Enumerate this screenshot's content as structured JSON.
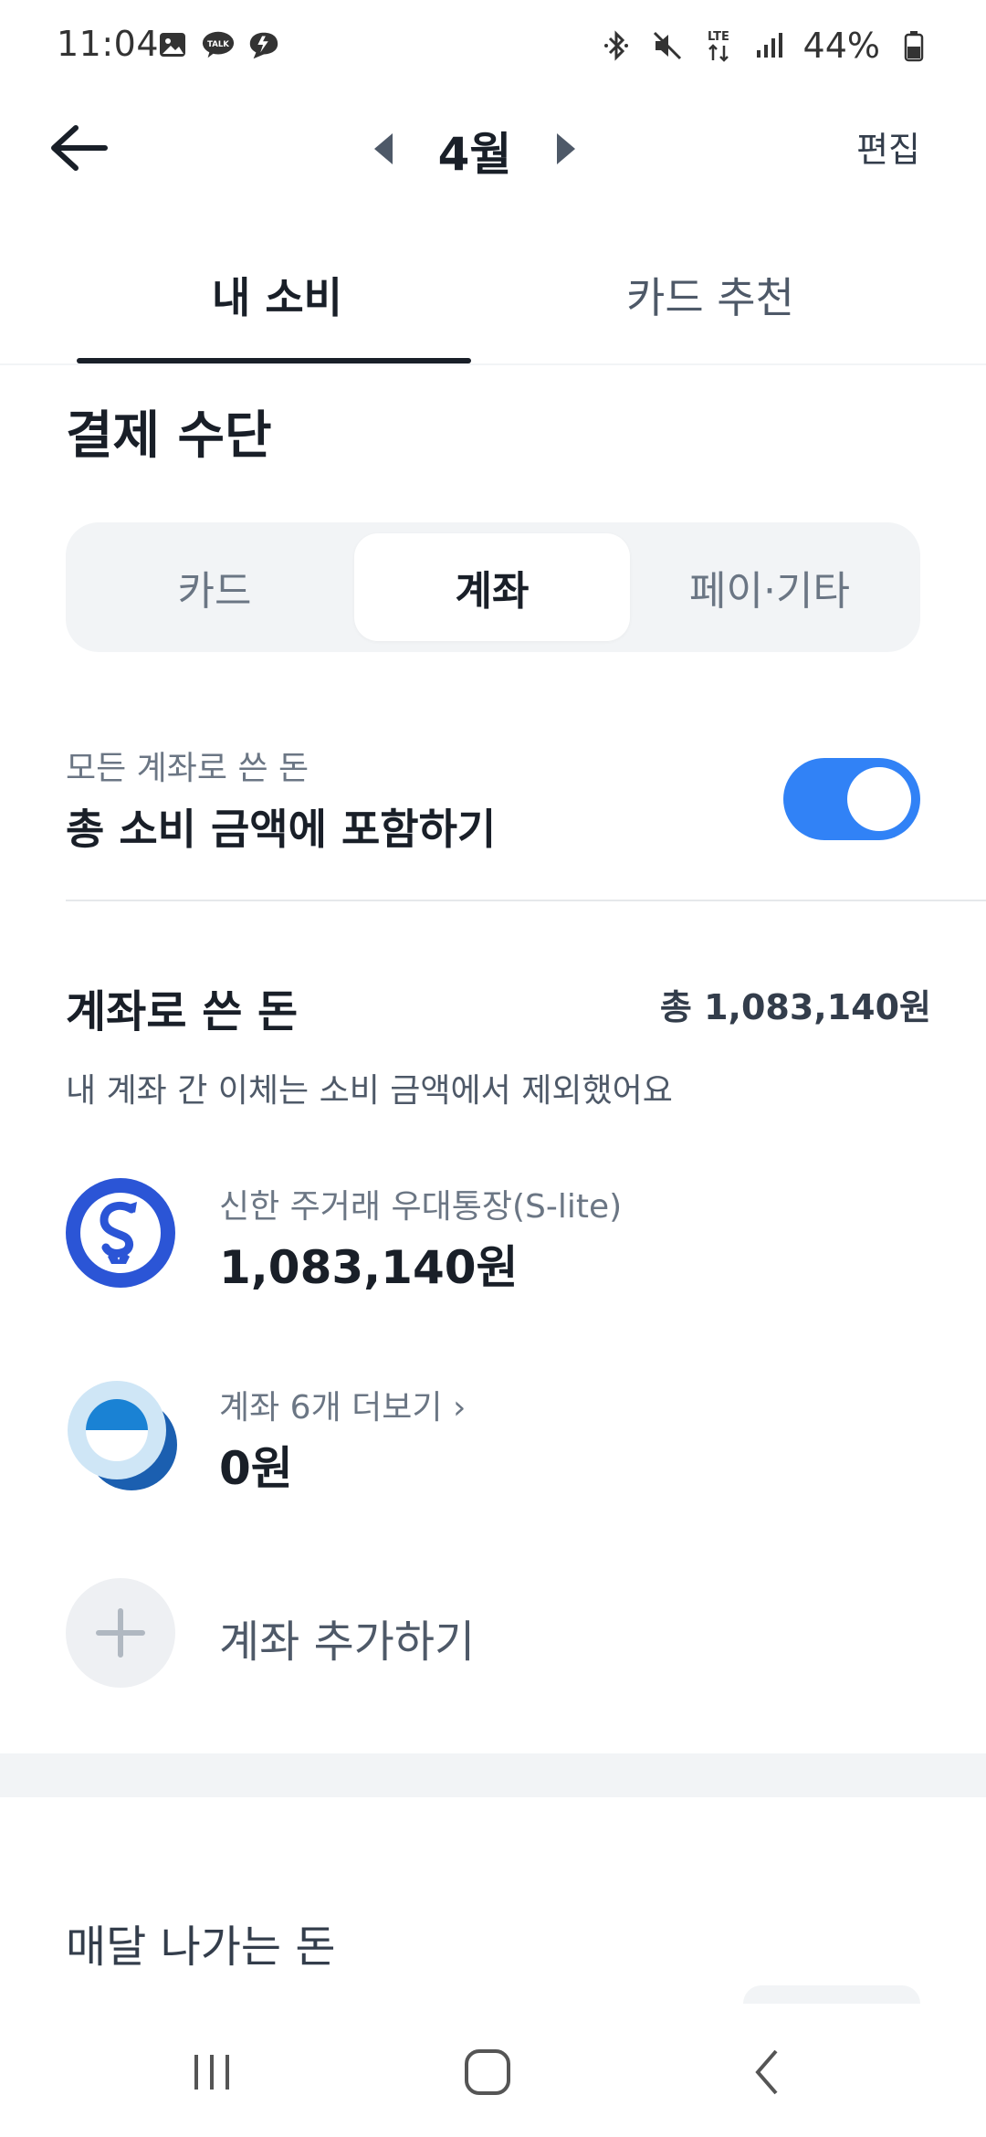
{
  "status_bar": {
    "time": "11:04",
    "battery": "44%",
    "left_icons": [
      "gallery-icon",
      "kakaotalk-icon",
      "chat-bubble-icon"
    ],
    "right_icons": [
      "bluetooth-icon",
      "mute-icon",
      "lte-icon",
      "signal-icon",
      "battery-icon"
    ]
  },
  "header": {
    "month": "4월",
    "edit_label": "편집"
  },
  "tabs": [
    {
      "label": "내 소비",
      "active": true
    },
    {
      "label": "카드 추천",
      "active": false
    }
  ],
  "section_title": "결제 수단",
  "segment": {
    "items": [
      "카드",
      "계좌",
      "페이·기타"
    ],
    "selected": "계좌"
  },
  "toggle_row": {
    "sub": "모든 계좌로 쓴 돈",
    "main": "총 소비 금액에 포함하기",
    "on": true
  },
  "accounts": {
    "title": "계좌로 쓴 돈",
    "total": "총 1,083,140원",
    "note": "내 계좌 간 이체는 소비 금액에서 제외했어요",
    "rows": [
      {
        "sub": "신한 주거래 우대통장(S-lite)",
        "amount": "1,083,140원"
      },
      {
        "sub": "계좌 6개 더보기 ›",
        "amount": "0원"
      }
    ],
    "add_label": "계좌 추가하기"
  },
  "monthly": {
    "title": "매달 나가는 돈"
  },
  "colors": {
    "accent": "#3182f6",
    "text_primary": "#191f28",
    "text_secondary": "#6b7684",
    "shinhan": "#2b55d6"
  }
}
